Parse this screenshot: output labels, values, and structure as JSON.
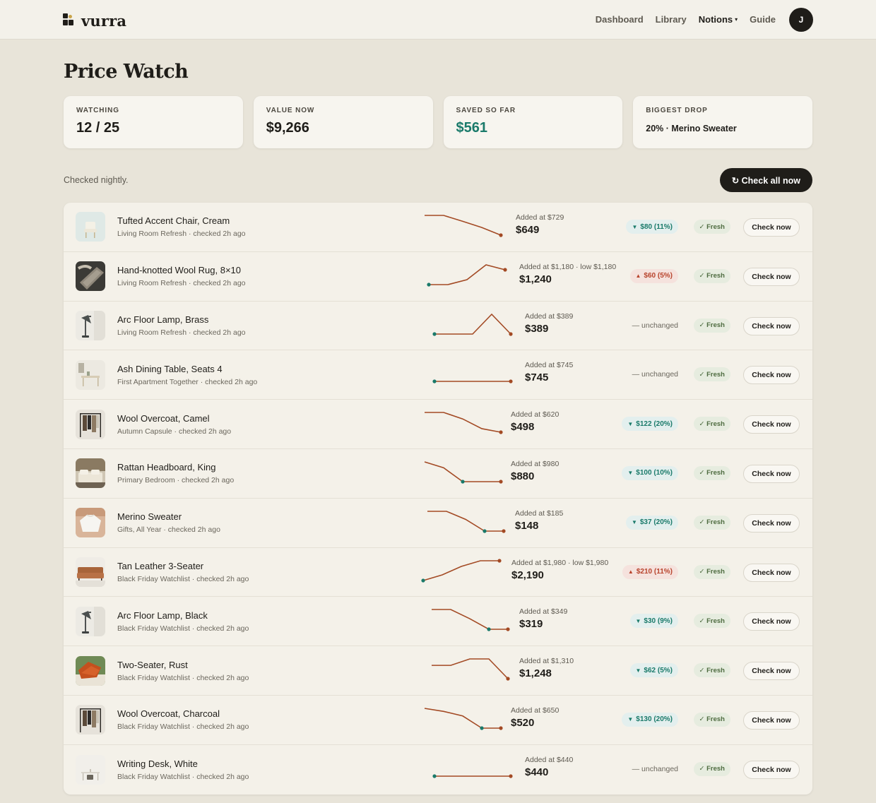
{
  "app": {
    "brand": "vurra",
    "nav": [
      "Dashboard",
      "Library",
      "Notions",
      "Guide"
    ],
    "nav_active": "Notions",
    "avatar_initial": "J",
    "colors": {
      "accent_dark": "#1f1d19",
      "green": "#1a7a6a",
      "red": "#b8432c",
      "line": "#a34a24"
    }
  },
  "page": {
    "title": "Price Watch",
    "stats": [
      {
        "label": "WATCHING",
        "value": "12 / 25"
      },
      {
        "label": "VALUE NOW",
        "value": "$9,266"
      },
      {
        "label": "SAVED SO FAR",
        "value": "$561"
      },
      {
        "label": "BIGGEST DROP",
        "value": "20% · Merino Sweater"
      }
    ],
    "note": "Checked nightly.",
    "check_all_label": "↻ Check all now",
    "fresh_label": "✓ Fresh",
    "check_now_label": "Check now"
  },
  "items": [
    {
      "name": "Tufted Accent Chair, Cream",
      "meta": "Living Room Refresh · checked 2h ago",
      "added": "Added at $729",
      "price": "$649",
      "delta": "$80 (11%)",
      "dir": "down",
      "thumb": "chair",
      "points": [
        729,
        729,
        705,
        680,
        649
      ]
    },
    {
      "name": "Hand-knotted Wool Rug, 8×10",
      "meta": "Living Room Refresh · checked 2h ago",
      "added": "Added at $1,180 · low $1,180",
      "price": "$1,240",
      "delta": "$60 (5%)",
      "dir": "up",
      "thumb": "rug",
      "points": [
        1180,
        1180,
        1200,
        1260,
        1240
      ]
    },
    {
      "name": "Arc Floor Lamp, Brass",
      "meta": "Living Room Refresh · checked 2h ago",
      "added": "Added at $389",
      "price": "$389",
      "delta": "— unchanged",
      "dir": "flat",
      "thumb": "lamp",
      "points": [
        389,
        389,
        389,
        420,
        389
      ]
    },
    {
      "name": "Ash Dining Table, Seats 4",
      "meta": "First Apartment Together · checked 2h ago",
      "added": "Added at $745",
      "price": "$745",
      "delta": "— unchanged",
      "dir": "flat",
      "thumb": "table",
      "points": [
        745,
        745,
        745,
        745,
        745
      ]
    },
    {
      "name": "Wool Overcoat, Camel",
      "meta": "Autumn Capsule · checked 2h ago",
      "added": "Added at $620",
      "price": "$498",
      "delta": "$122 (20%)",
      "dir": "down",
      "thumb": "coat",
      "points": [
        620,
        620,
        580,
        520,
        498
      ]
    },
    {
      "name": "Rattan Headboard, King",
      "meta": "Primary Bedroom · checked 2h ago",
      "added": "Added at $980",
      "price": "$880",
      "delta": "$100 (10%)",
      "dir": "down",
      "thumb": "headboard",
      "points": [
        980,
        950,
        880,
        880,
        880
      ]
    },
    {
      "name": "Merino Sweater",
      "meta": "Gifts, All Year · checked 2h ago",
      "added": "Added at $185",
      "price": "$148",
      "delta": "$37 (20%)",
      "dir": "down",
      "thumb": "sweater",
      "points": [
        185,
        185,
        170,
        148,
        148
      ]
    },
    {
      "name": "Tan Leather 3-Seater",
      "meta": "Black Friday Watchlist · checked 2h ago",
      "added": "Added at $1,980 · low $1,980",
      "price": "$2,190",
      "delta": "$210 (11%)",
      "dir": "up",
      "thumb": "sofa",
      "points": [
        1980,
        2040,
        2130,
        2190,
        2190
      ]
    },
    {
      "name": "Arc Floor Lamp, Black",
      "meta": "Black Friday Watchlist · checked 2h ago",
      "added": "Added at $349",
      "price": "$319",
      "delta": "$30 (9%)",
      "dir": "down",
      "thumb": "lamp",
      "points": [
        349,
        349,
        335,
        319,
        319
      ]
    },
    {
      "name": "Two-Seater, Rust",
      "meta": "Black Friday Watchlist · checked 2h ago",
      "added": "Added at $1,310",
      "price": "$1,248",
      "delta": "$62 (5%)",
      "dir": "down",
      "thumb": "loveseat",
      "points": [
        1310,
        1310,
        1340,
        1340,
        1248
      ]
    },
    {
      "name": "Wool Overcoat, Charcoal",
      "meta": "Black Friday Watchlist · checked 2h ago",
      "added": "Added at $650",
      "price": "$520",
      "delta": "$130 (20%)",
      "dir": "down",
      "thumb": "coat",
      "points": [
        650,
        630,
        600,
        520,
        520
      ]
    },
    {
      "name": "Writing Desk, White",
      "meta": "Black Friday Watchlist · checked 2h ago",
      "added": "Added at $440",
      "price": "$440",
      "delta": "— unchanged",
      "dir": "flat",
      "thumb": "desk",
      "points": [
        440,
        440,
        440,
        440,
        440
      ]
    }
  ]
}
